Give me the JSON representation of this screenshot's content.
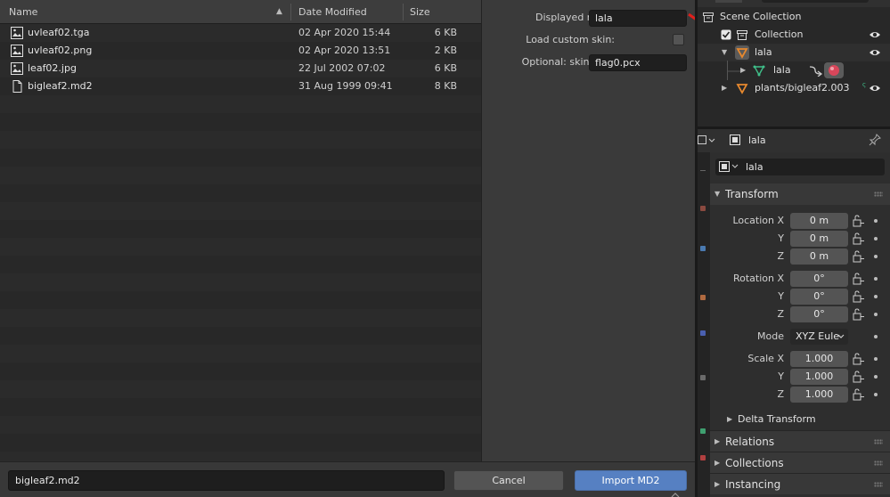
{
  "file_browser": {
    "columns": {
      "name": "Name",
      "date": "Date Modified",
      "size": "Size"
    },
    "files": [
      {
        "name": "uvleaf02.tga",
        "date": "02 Apr 2020 15:44",
        "size": "6 KB",
        "icon": "image-file-icon"
      },
      {
        "name": "uvleaf02.png",
        "date": "02 Apr 2020 13:51",
        "size": "2 KB",
        "icon": "image-file-icon"
      },
      {
        "name": "leaf02.jpg",
        "date": "22 Jul 2002 07:02",
        "size": "6 KB",
        "icon": "image-file-icon"
      },
      {
        "name": "bigleaf2.md2",
        "date": "31 Aug 1999 09:41",
        "size": "8 KB",
        "icon": "file-icon"
      }
    ]
  },
  "bottom_bar": {
    "filename": "bigleaf2.md2",
    "cancel_label": "Cancel",
    "import_label": "Import MD2"
  },
  "options": {
    "displayed_name_label": "Displayed name",
    "displayed_name_value": "lala",
    "load_custom_skin_label": "Load custom skin:",
    "load_custom_skin_checked": false,
    "skin_path_label": "Optional: skin path",
    "skin_path_value": "flag0.pcx"
  },
  "outliner": {
    "scene_collection": "Scene Collection",
    "collection": "Collection",
    "object_name": "lala",
    "mesh_name": "lala",
    "second_object": "plants/bigleaf2.003"
  },
  "properties": {
    "header_object": "lala",
    "object_name": "lala",
    "transform_label": "Transform",
    "location_x_label": "Location X",
    "location_x": "0 m",
    "location_y_label": "Y",
    "location_y": "0 m",
    "location_z_label": "Z",
    "location_z": "0 m",
    "rotation_x_label": "Rotation X",
    "rotation_x": "0°",
    "rotation_y_label": "Y",
    "rotation_y": "0°",
    "rotation_z_label": "Z",
    "rotation_z": "0°",
    "mode_label": "Mode",
    "mode_value": "XYZ Eule",
    "scale_x_label": "Scale X",
    "scale_x": "1.000",
    "scale_y_label": "Y",
    "scale_y": "1.000",
    "scale_z_label": "Z",
    "scale_z": "1.000",
    "delta_transform_label": "Delta Transform",
    "relations_label": "Relations",
    "collections_label": "Collections",
    "instancing_label": "Instancing"
  },
  "colors": {
    "accent_button": "#5680c2",
    "annotation_arrow": "#e0201c",
    "object_orange": "#e8892e",
    "mesh_green": "#3fc08a"
  }
}
